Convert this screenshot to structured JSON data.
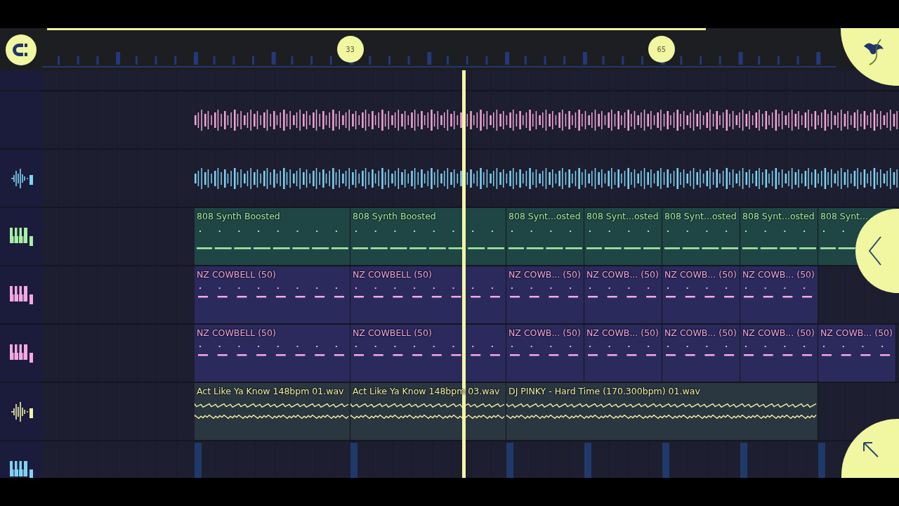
{
  "ruler": {
    "markers": [
      {
        "label": "33"
      },
      {
        "label": "65"
      }
    ]
  },
  "tracks": [
    {
      "kind": "empty"
    },
    {
      "kind": "hits",
      "color": "#f2a6d6"
    },
    {
      "kind": "hits",
      "color": "#7fd3f2"
    },
    {
      "kind": "notes",
      "color": "#a6f0a6",
      "clips": [
        {
          "label": "808 Synth Boosted",
          "kind": "full"
        },
        {
          "label": "808 Synth Boosted",
          "kind": "full"
        },
        {
          "label": "808 Synt...osted",
          "kind": "half"
        },
        {
          "label": "808 Synt...osted",
          "kind": "half"
        },
        {
          "label": "808 Synt...osted",
          "kind": "half"
        },
        {
          "label": "808 Synt...osted",
          "kind": "half"
        },
        {
          "label": "808 Synt...",
          "kind": "half"
        }
      ]
    },
    {
      "kind": "notes",
      "color": "#f4a8e4",
      "clips": [
        {
          "label": "NZ COWBELL (50)",
          "kind": "full"
        },
        {
          "label": "NZ COWBELL (50)",
          "kind": "full"
        },
        {
          "label": "NZ COWB... (50)",
          "kind": "half"
        },
        {
          "label": "NZ COWB... (50)",
          "kind": "half"
        },
        {
          "label": "NZ COWB... (50)",
          "kind": "half"
        },
        {
          "label": "NZ COWB... (50)",
          "kind": "half"
        }
      ]
    },
    {
      "kind": "notes",
      "color": "#f4a8e4",
      "clips": [
        {
          "label": "NZ COWBELL (50)",
          "kind": "full"
        },
        {
          "label": "NZ COWBELL (50)",
          "kind": "full"
        },
        {
          "label": "NZ COWB... (50)",
          "kind": "half"
        },
        {
          "label": "NZ COWB... (50)",
          "kind": "half"
        },
        {
          "label": "NZ COWB... (50)",
          "kind": "half"
        },
        {
          "label": "NZ COWB... (50)",
          "kind": "half"
        },
        {
          "label": "NZ COWB... (50)",
          "kind": "half"
        }
      ]
    },
    {
      "kind": "audio",
      "color": "#f2f2a6",
      "clips": [
        {
          "label": "Act Like Ya Know 148bpm 01.wav",
          "kind": "full"
        },
        {
          "label": "Act Like Ya Know 148bpm 03.wav",
          "kind": "full"
        },
        {
          "label": "DJ PINKY - Hard Time (170.300bpm) 01.wav",
          "kind": "double"
        }
      ]
    },
    {
      "kind": "stubs",
      "color": "#7fd3f2",
      "clips": [
        {
          "kind": "full"
        },
        {
          "kind": "full"
        },
        {
          "kind": "half"
        },
        {
          "kind": "half"
        },
        {
          "kind": "half"
        },
        {
          "kind": "half"
        },
        {
          "kind": "half"
        }
      ]
    }
  ]
}
